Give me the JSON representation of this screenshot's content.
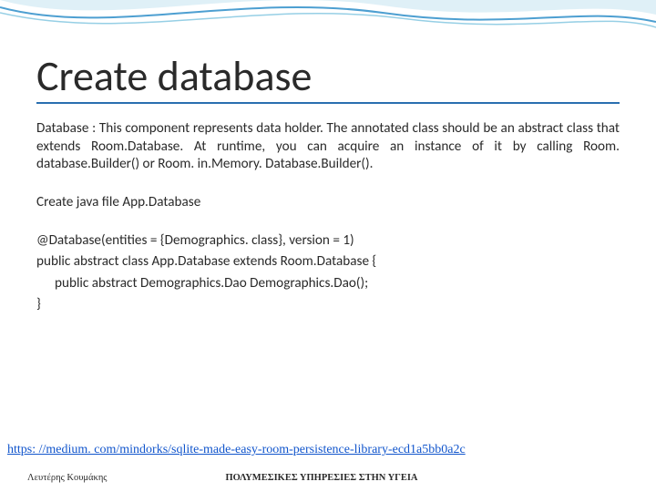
{
  "slide": {
    "title": "Create database",
    "paragraph": "Database : This component represents data holder. The annotated class should be an abstract class that extends Room.Database. At runtime, you can acquire an instance of it by calling Room. database.Builder() or Room. in.Memory. Database.Builder().",
    "subline": "Create java file App.Database",
    "code": {
      "l1": "@Database(entities = {Demographics. class}, version = 1)",
      "l2": "public abstract class App.Database extends Room.Database {",
      "l3": "public abstract Demographics.Dao Demographics.Dao();",
      "l4": "}"
    },
    "link": "https: //medium. com/mindorks/sqlite-made-easy-room-persistence-library-ecd1a5bb0a2c",
    "footer": {
      "author": "Λευτέρης Κουμάκης",
      "course": "ΠΟΛΥΜΕΣΙΚΕΣ ΥΠΗΡΕΣΙΕΣ ΣΤΗΝ ΥΓΕΙΑ"
    }
  }
}
